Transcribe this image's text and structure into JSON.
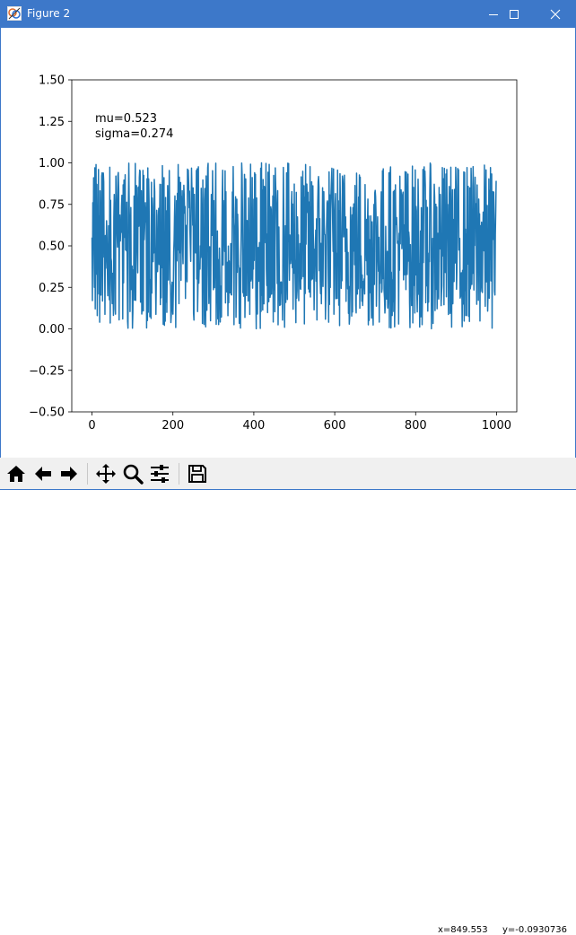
{
  "window": {
    "title": "Figure 2",
    "accent_color": "#3d78c9",
    "controls": [
      "minimize-icon",
      "maximize-icon",
      "close-icon"
    ]
  },
  "chart_data": {
    "type": "line",
    "title": "",
    "xlabel": "",
    "ylabel": "",
    "xlim": [
      -50,
      1050
    ],
    "ylim": [
      -0.5,
      1.5
    ],
    "x_ticks": [
      "0",
      "200",
      "400",
      "600",
      "800",
      "1000"
    ],
    "y_ticks": [
      "1.50",
      "1.25",
      "1.00",
      "0.75",
      "0.50",
      "0.25",
      "0.00",
      "−0.25",
      "−0.50"
    ],
    "annotations": [
      "mu=0.523",
      "sigma=0.274"
    ],
    "grid": false,
    "legend": "none",
    "series": [
      {
        "color": "#1f77b4",
        "x_start": 0,
        "x_end": 999,
        "count": 1000,
        "mean": 0.523,
        "std": 0.274,
        "distribution": "uniform",
        "range": [
          0.0,
          1.0
        ],
        "sample_values": [
          0.55,
          0.17,
          0.76,
          0.48,
          0.91,
          0.45,
          0.25,
          0.97,
          0.12,
          0.63,
          0.99,
          0.33,
          0.87,
          0.08,
          0.71,
          0.52,
          0.96,
          0.21,
          0.68,
          0.04
        ]
      }
    ]
  },
  "toolbar": {
    "buttons": [
      "home-icon",
      "back-icon",
      "forward-icon",
      "pan-icon",
      "zoom-icon",
      "configure-subplots-icon",
      "save-icon"
    ],
    "coords_x": "x=849.553",
    "coords_y": "y=-0.0930736"
  }
}
